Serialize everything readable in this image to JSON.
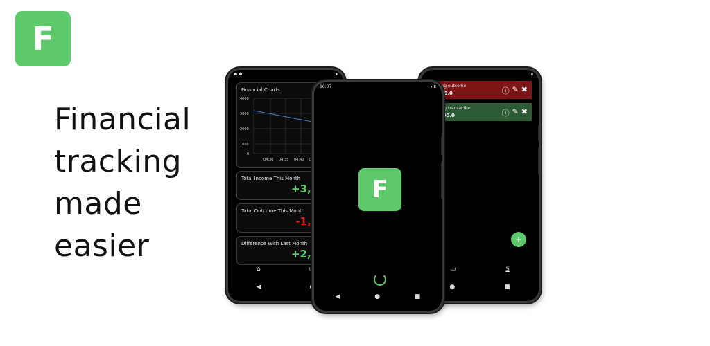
{
  "logo": {
    "letter": "F",
    "color": "#5dc96b"
  },
  "headline": [
    "Financial",
    "tracking",
    "made",
    "easier"
  ],
  "left_phone": {
    "chart_card": {
      "title": "Financial Charts",
      "y_ticks": [
        "4000",
        "3000",
        "2000",
        "1000",
        "0"
      ],
      "x_ticks": [
        "04:30",
        "04:35",
        "04:40",
        "04:45"
      ]
    },
    "cards": [
      {
        "title": "Total Income This Month",
        "value": "+3,200",
        "color": "#5dc96b"
      },
      {
        "title": "Total Outcome This Month",
        "value": "-1,200",
        "color": "#e21b1b"
      },
      {
        "title": "Difference With Last Month",
        "value": "+2,000",
        "color": "#5dc96b"
      }
    ],
    "nav_icons": [
      "home-icon",
      "card-icon"
    ]
  },
  "center_phone": {
    "status_time": "10:07",
    "logo_letter": "F",
    "loading": true
  },
  "right_phone": {
    "transactions": [
      {
        "description": "Testing outcome",
        "amount": "-1200.0",
        "color": "#7c1515"
      },
      {
        "description": "Testing transaction",
        "amount": "+3200.0",
        "color": "#2c5a33"
      }
    ],
    "fab_label": "+",
    "nav_icons": [
      "card-icon",
      "dollar-icon"
    ]
  },
  "navbar": {
    "back": "◀",
    "home": "●",
    "recent": "■"
  }
}
